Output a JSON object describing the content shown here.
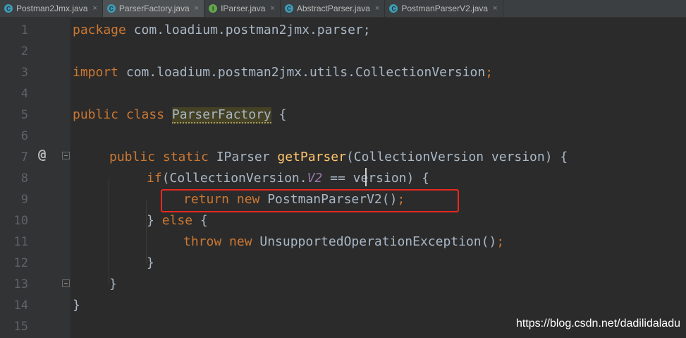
{
  "tabs": [
    {
      "label": "Postman2Jmx.java",
      "icon": "class-icon",
      "close": "×",
      "active": false
    },
    {
      "label": "ParserFactory.java",
      "icon": "class-icon",
      "close": "×",
      "active": true
    },
    {
      "label": "IParser.java",
      "icon": "interface-icon",
      "close": "×",
      "active": false
    },
    {
      "label": "AbstractParser.java",
      "icon": "abstract-class-icon",
      "close": "×",
      "active": false
    },
    {
      "label": "PostmanParserV2.java",
      "icon": "class-icon",
      "close": "×",
      "active": false
    }
  ],
  "tab_icon_glyphs": {
    "class": "C",
    "interface": "I"
  },
  "line_numbers": [
    "1",
    "2",
    "3",
    "4",
    "5",
    "6",
    "7",
    "8",
    "9",
    "10",
    "11",
    "12",
    "13",
    "14",
    "15"
  ],
  "gutter": {
    "override_marker": "@"
  },
  "code": {
    "l1": {
      "kw": "package",
      "rest": " com.loadium.postman2jmx.parser;"
    },
    "l3": {
      "kw": "import",
      "rest": " com.loadium.postman2jmx.utils.CollectionVersion",
      "semi": ";"
    },
    "l5": {
      "kw": "public class ",
      "cls": "ParserFactory",
      "rest": " {"
    },
    "l7": {
      "kw": "public static ",
      "type": "IParser ",
      "fn": "getParser",
      "rest": "(CollectionVersion version) {"
    },
    "l8": {
      "kw": "if",
      "a": "(CollectionVersion.",
      "cst": "V2",
      "b": " == version) {"
    },
    "l9": {
      "kw": "return new ",
      "rest": "PostmanParserV2()",
      "semi": ";"
    },
    "l10": {
      "a": "} ",
      "kw": "else",
      "b": " {"
    },
    "l11": {
      "kw": "throw new ",
      "rest": "UnsupportedOperationException()",
      "semi": ";"
    },
    "l12": "}",
    "l13": "}",
    "l14": "}"
  },
  "watermark": "https://blog.csdn.net/dadilidaladu",
  "colors": {
    "background": "#2b2b2b",
    "keyword": "#cc7832",
    "method": "#ffc66d",
    "constant": "#9876aa",
    "text": "#a9b7c6",
    "highlight_box": "#e8281f"
  }
}
